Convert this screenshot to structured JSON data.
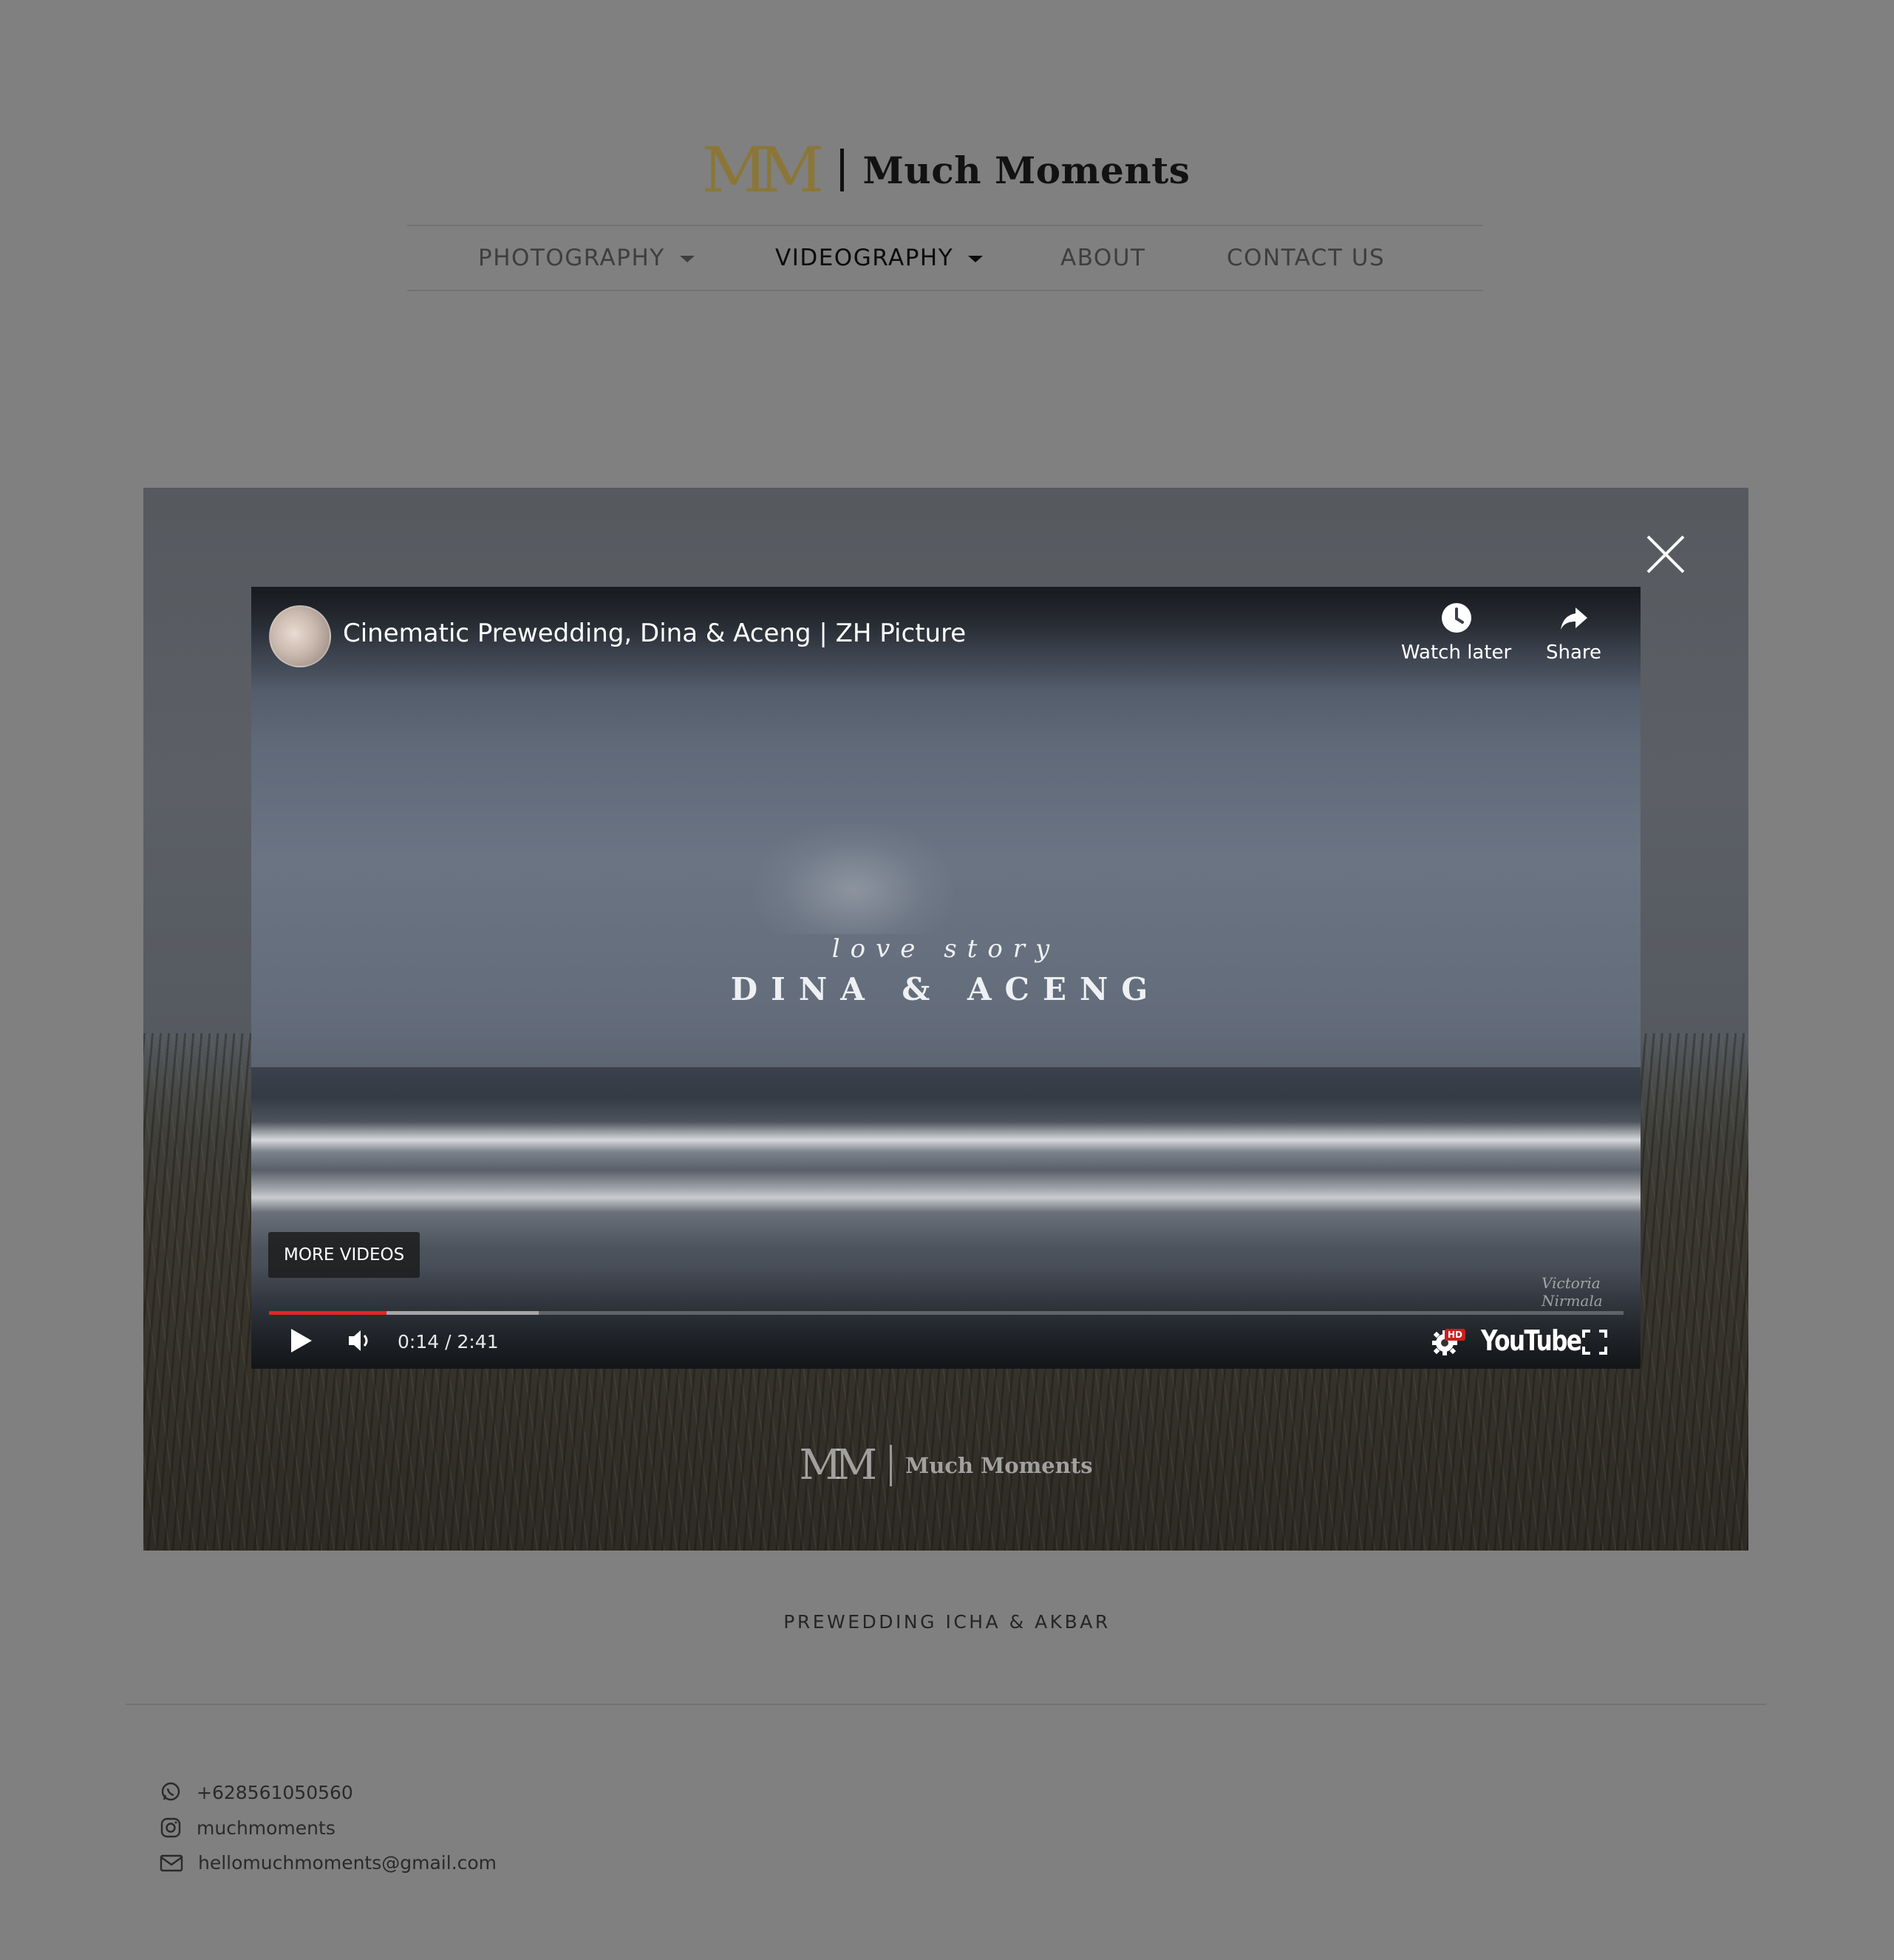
{
  "brand": {
    "mark": "MM",
    "name": "Much Moments"
  },
  "nav": [
    {
      "label": "PHOTOGRAPHY",
      "dropdown": true
    },
    {
      "label": "VIDEOGRAPHY",
      "dropdown": true,
      "active": true
    },
    {
      "label": "ABOUT"
    },
    {
      "label": "CONTACT US"
    }
  ],
  "lightbox": {
    "video": {
      "title": "Cinematic Prewedding, Dina & Aceng | ZH Picture",
      "watch_later": "Watch later",
      "share": "Share",
      "overlay_line1": "love story",
      "overlay_line2": "DINA & ACENG",
      "more_videos": "MORE VIDEOS",
      "watermark": "Victoria Nirmala",
      "time": "0:14 / 2:41",
      "played_fraction": 0.087,
      "buffered_fraction": 0.199,
      "hd_badge": "HD",
      "youtube_logo": "YouTube"
    },
    "background_brand": {
      "mark": "MM",
      "name": "Much Moments"
    }
  },
  "caption": "PREWEDDING ICHA & AKBAR",
  "contacts": [
    {
      "icon": "whatsapp-icon",
      "text": "+628561050560"
    },
    {
      "icon": "instagram-icon",
      "text": "muchmoments"
    },
    {
      "icon": "mail-icon",
      "text": "hellomuchmoments@gmail.com"
    }
  ],
  "colors": {
    "overlay": "#808080",
    "brand_gold": "#8a7738",
    "progress": "#e02626"
  }
}
